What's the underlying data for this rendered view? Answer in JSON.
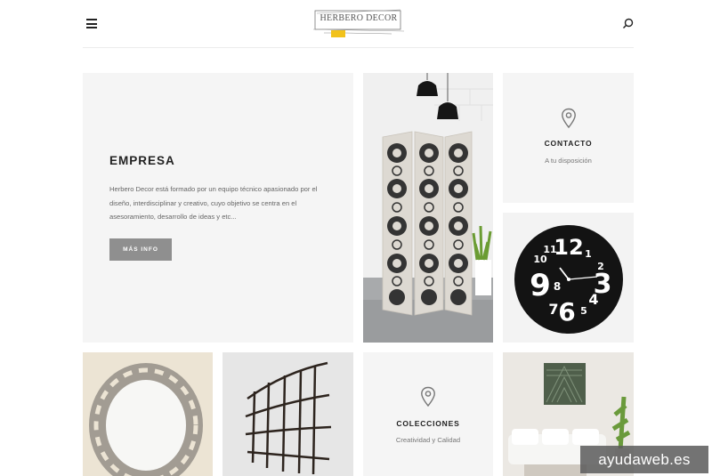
{
  "header": {
    "logo_text": "HERBERO DECOR",
    "menu_icon": "hamburger-menu-icon",
    "search_icon": "search-icon"
  },
  "empresa": {
    "title": "EMPRESA",
    "description": "Herbero Decor está formado por un equipo técnico apasionado por el diseño, interdisciplinar y creativo, cuyo objetivo se centra en el asesoramiento, desarrollo de ideas y etc...",
    "button_label": "MÁS INFO"
  },
  "contacto": {
    "icon": "map-pin-icon",
    "title": "CONTACTO",
    "subtitle": "A tu disposición"
  },
  "colecciones": {
    "icon": "map-pin-icon",
    "title": "COLECCIONES",
    "subtitle": "Creatividad y Calidad"
  },
  "reloj": {
    "numbers": [
      "12",
      "1",
      "2",
      "3",
      "4",
      "5",
      "6",
      "7",
      "8",
      "9",
      "10",
      "11"
    ]
  },
  "watermark": "ayudaweb.es",
  "colors": {
    "accent_yellow": "#f2c21b",
    "tile_grey": "#f5f5f5",
    "button_grey": "#8f8f8f"
  }
}
